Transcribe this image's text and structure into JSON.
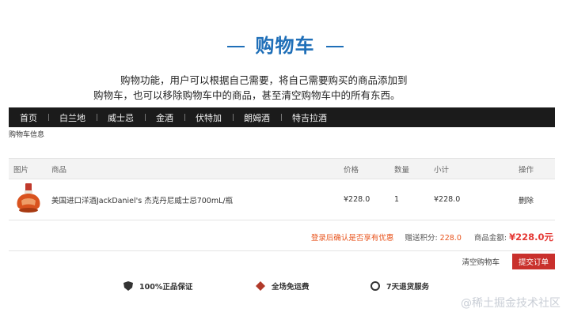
{
  "slide": {
    "title": "购物车",
    "description_line1": "购物功能，用户可以根据自己需要，将自己需要购买的商品添加到",
    "description_line2": "购物车，也可以移除购物车中的商品，甚至清空购物车中的所有东西。"
  },
  "nav": {
    "items": [
      "首页",
      "白兰地",
      "威士忌",
      "金酒",
      "伏特加",
      "朗姆酒",
      "特吉拉酒"
    ]
  },
  "breadcrumb": "购物车信息",
  "table": {
    "headers": {
      "image": "图片",
      "name": "商品",
      "price": "价格",
      "qty": "数量",
      "subtotal": "小计",
      "op": "操作"
    },
    "rows": [
      {
        "image_icon": "liquor-bottle-icon",
        "name": "美国进口洋酒JackDaniel's 杰克丹尼威士忌700mL/瓶",
        "price": "¥228.0",
        "qty": "1",
        "subtotal": "¥228.0",
        "op": "删除"
      }
    ]
  },
  "summary": {
    "tip": "登录后确认是否享有优惠",
    "points_label": "赠送积分:",
    "points_value": "228.0",
    "amount_label": "商品金额:",
    "amount_value": "¥228.0元"
  },
  "actions": {
    "clear": "清空购物车",
    "submit": "提交订单"
  },
  "services": [
    "100%正品保证",
    "全场免运费",
    "7天退货服务"
  ],
  "watermark": "@稀土掘金技术社区",
  "colors": {
    "title": "#1f6fb8",
    "nav_bg": "#1b1b1b",
    "accent_orange": "#e8541d",
    "price_red": "#e53935",
    "submit_bg": "#c9302c"
  }
}
